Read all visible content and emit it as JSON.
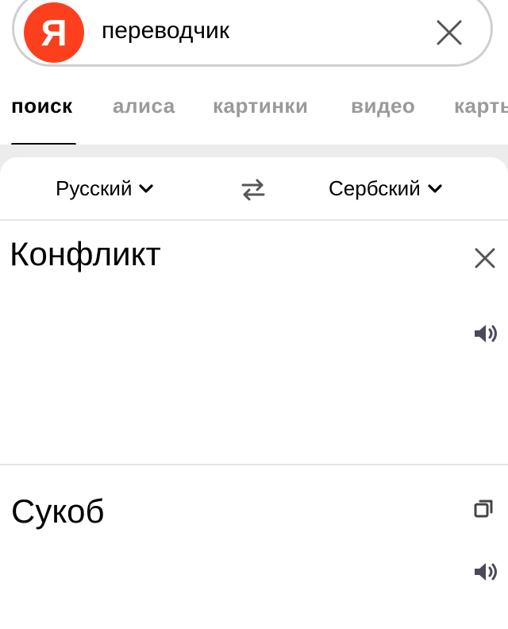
{
  "search": {
    "logo_letter": "Я",
    "query": "переводчик",
    "logo_color": "#fc3f1d"
  },
  "tabs": [
    {
      "label": "поиск",
      "active": true
    },
    {
      "label": "алиса",
      "active": false
    },
    {
      "label": "картинки",
      "active": false
    },
    {
      "label": "видео",
      "active": false
    },
    {
      "label": "карты",
      "active": false
    }
  ],
  "translator": {
    "source_lang": "Русский",
    "target_lang": "Сербский",
    "source_text": "Конфликт",
    "result_text": "Сукоб"
  },
  "icons": {
    "clear": "close-icon",
    "swap": "swap-arrows-icon",
    "speaker": "speaker-icon",
    "copy": "copy-icon",
    "dropdown": "chevron-down-icon"
  }
}
